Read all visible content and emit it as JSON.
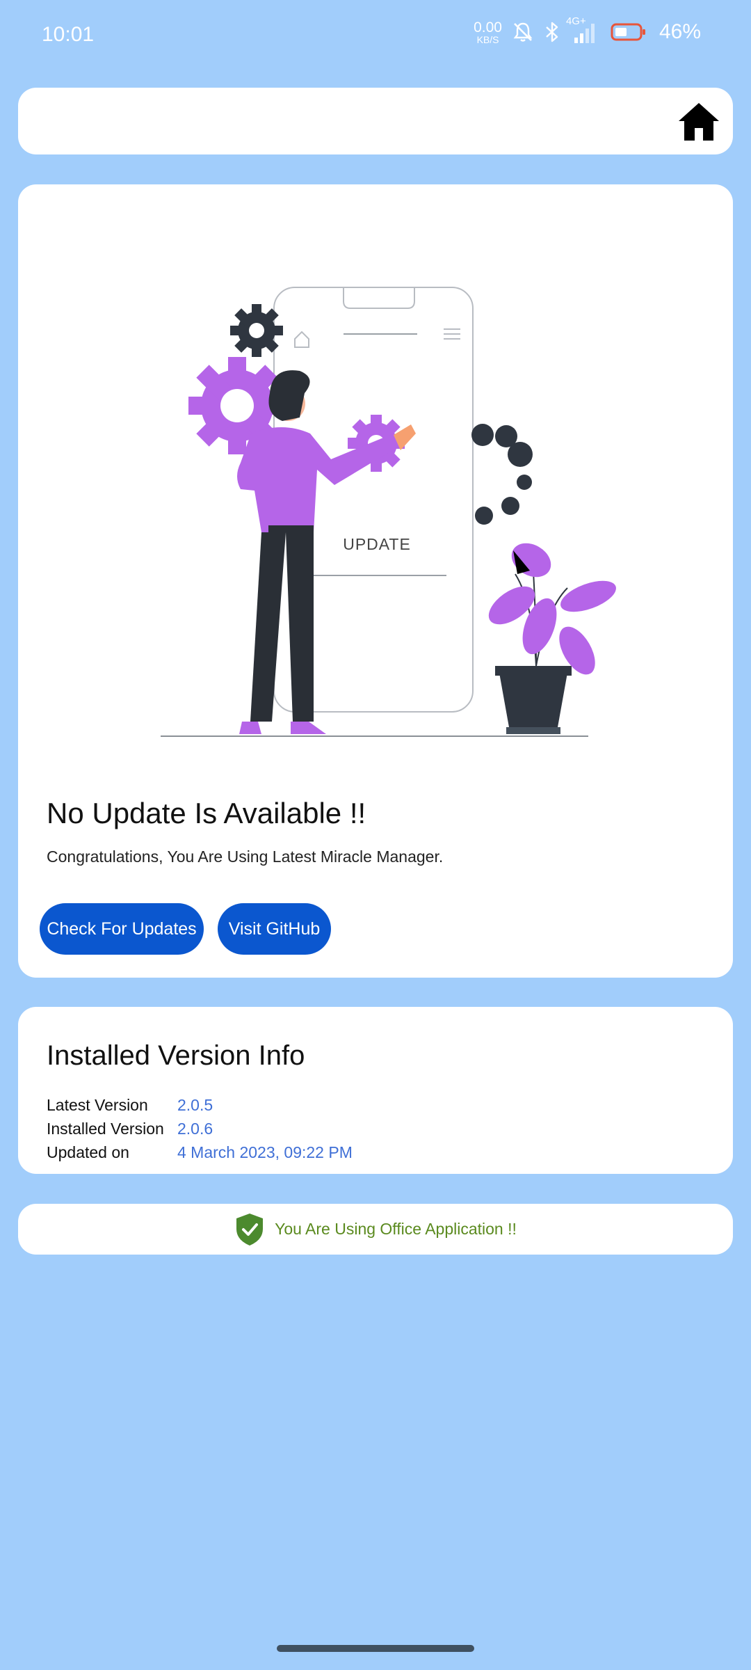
{
  "status_bar": {
    "time": "10:01",
    "net_speed_value": "0.00",
    "net_speed_unit": "KB/S",
    "network_type": "4G+",
    "battery_percent": "46%"
  },
  "top_bar": {
    "home_icon": "home-icon"
  },
  "update_card": {
    "illustration_label": "UPDATE",
    "title": "No Update Is Available !!",
    "message": "Congratulations, You Are Using Latest Miracle Manager.",
    "check_button": "Check For Updates",
    "github_button": "Visit GitHub"
  },
  "version_info": {
    "title": "Installed Version Info",
    "rows": [
      {
        "label": "Latest Version",
        "value": "2.0.5"
      },
      {
        "label": "Installed Version",
        "value": "2.0.6"
      },
      {
        "label": "Updated on",
        "value": "4 March 2023, 09:22 PM"
      }
    ]
  },
  "office_notice": {
    "icon": "shield-check-icon",
    "text": "You Are Using Office Application !!"
  },
  "colors": {
    "background": "#a1cdfb",
    "button": "#0b57cf",
    "link_value": "#3f6fd6",
    "office_text": "#5a8a1e",
    "illustration_accent": "#b565e8"
  }
}
